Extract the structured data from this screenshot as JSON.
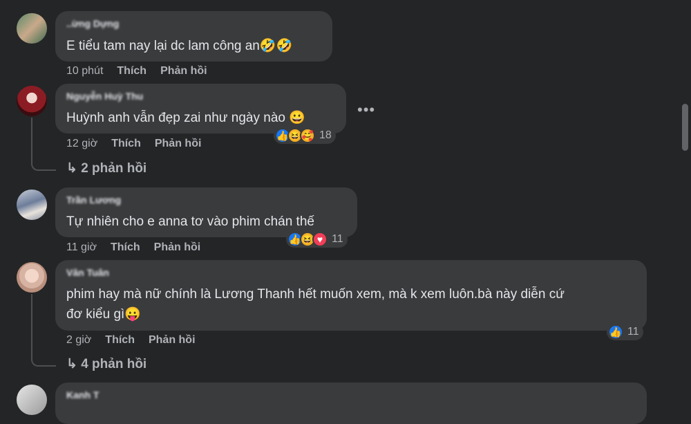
{
  "comments": [
    {
      "name": "..ừng Dựng",
      "text": "E tiểu tam nay lại dc lam công an🤣🤣",
      "time": "10 phút",
      "like": "Thích",
      "reply": "Phản hồi"
    },
    {
      "name": "Nguyễn Huỳ Thu",
      "text": "Huỳnh anh vẫn đẹp zai như ngày nào 😀",
      "time": "12 giờ",
      "like": "Thích",
      "reply": "Phản hồi",
      "reaction_icons": [
        "like-icon",
        "haha-icon",
        "care-icon"
      ],
      "reaction_count": "18",
      "replies": "2 phản hồi",
      "more": "•••"
    },
    {
      "name": "Trần Lương",
      "text": "Tự nhiên cho e anna tơ vào phim chán thế",
      "time": "11 giờ",
      "like": "Thích",
      "reply": "Phản hồi",
      "reaction_icons": [
        "like-icon",
        "haha-icon",
        "love-icon"
      ],
      "reaction_count": "11"
    },
    {
      "name": "Vân Tuân",
      "text_line1": "phim hay mà nữ chính là Lương Thanh hết muốn xem, mà k xem luôn.bà này diễn cứ",
      "text_line2": "đơ kiểu gì😛",
      "time": "2 giờ",
      "like": "Thích",
      "reply": "Phản hồi",
      "reaction_icons": [
        "like-icon"
      ],
      "reaction_count": "11",
      "replies": "4 phản hồi"
    },
    {
      "name": "Kanh T"
    }
  ],
  "reply_arrow": "↳",
  "colors": {
    "background": "#242526",
    "bubble": "#3a3b3c",
    "like": "#1877f2",
    "love": "#f33e58",
    "haha": "#f7b125"
  }
}
